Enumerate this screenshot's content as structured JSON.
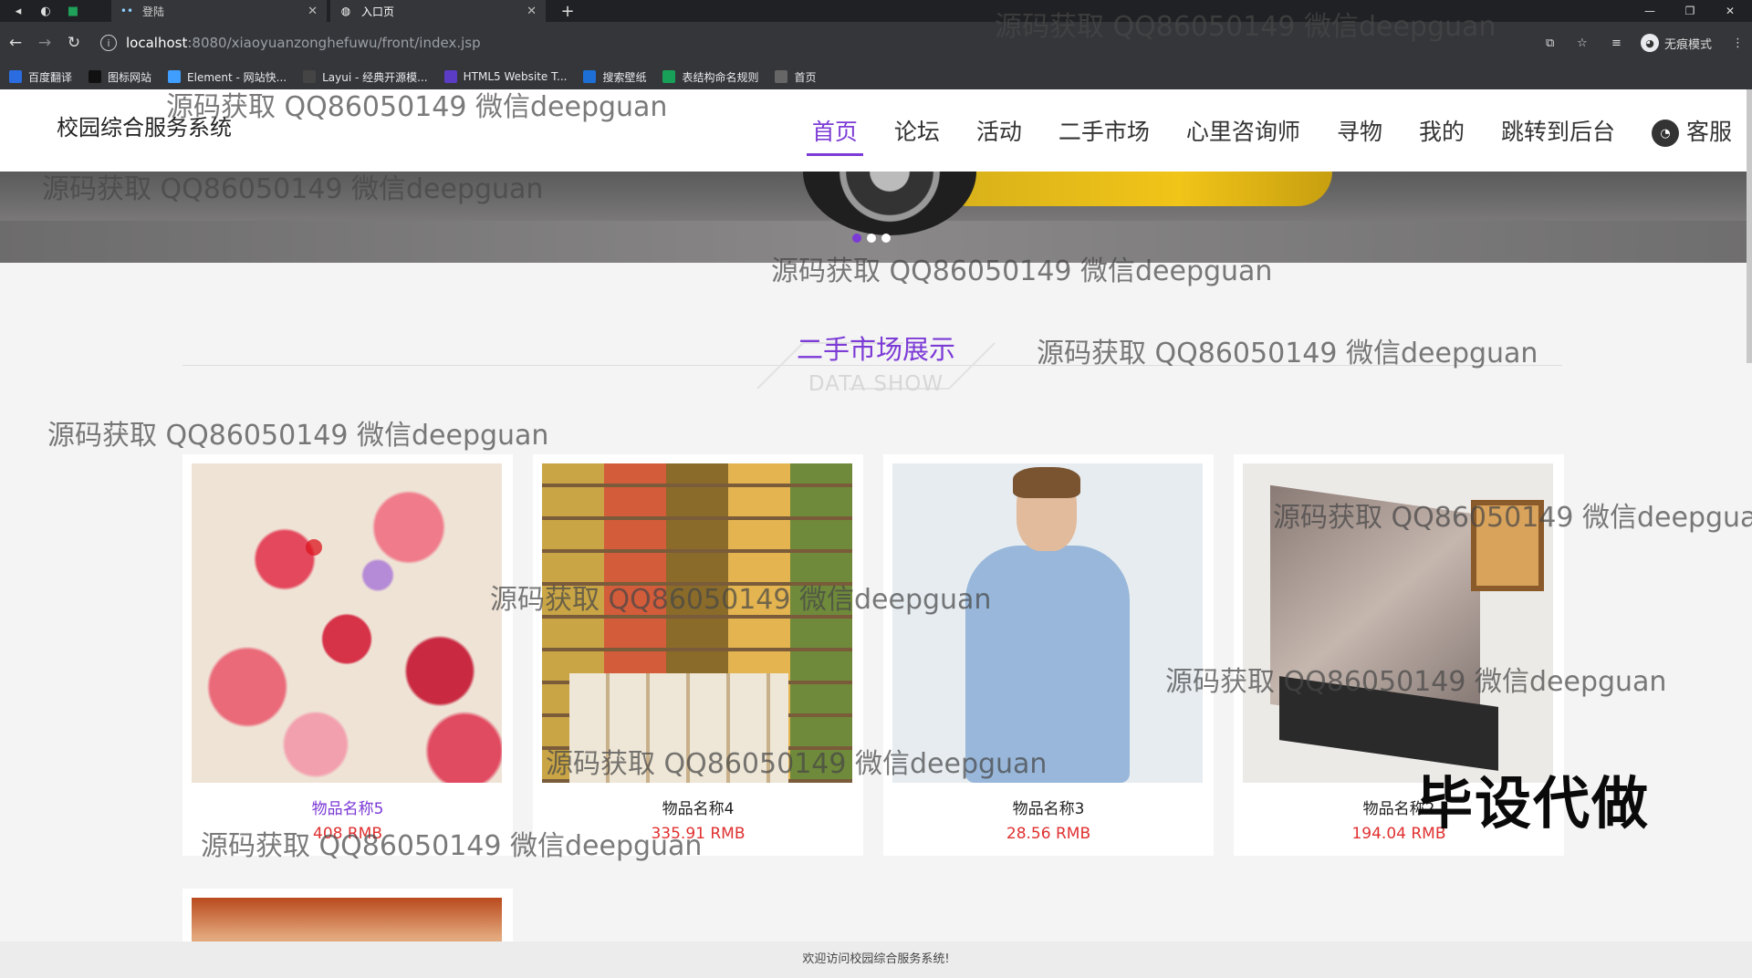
{
  "browser": {
    "tabs": [
      {
        "label": "登陆"
      },
      {
        "label": "入口页"
      }
    ],
    "url_host": "localhost",
    "url_path": ":8080/xiaoyuanzonghefuwu/front/index.jsp",
    "incognito_label": "无痕模式",
    "bookmarks": [
      {
        "label": "百度翻译",
        "color": "#2b6de0"
      },
      {
        "label": "图标网站",
        "color": "#111111"
      },
      {
        "label": "Element - 网站快...",
        "color": "#409eff"
      },
      {
        "label": "Layui - 经典开源模...",
        "color": "#444444"
      },
      {
        "label": "HTML5 Website T...",
        "color": "#5b3cc4"
      },
      {
        "label": "搜索壁纸",
        "color": "#1d6fd6"
      },
      {
        "label": "表结构命名规则",
        "color": "#18a058"
      },
      {
        "label": "首页",
        "color": "#666666"
      }
    ]
  },
  "site": {
    "brand": "校园综合服务系统",
    "menu": [
      {
        "label": "首页",
        "active": true
      },
      {
        "label": "论坛"
      },
      {
        "label": "活动"
      },
      {
        "label": "二手市场"
      },
      {
        "label": "心里咨询师"
      },
      {
        "label": "寻物"
      },
      {
        "label": "我的"
      },
      {
        "label": "跳转到后台"
      }
    ],
    "service_label": "客服",
    "accent_color": "#7c3bd6"
  },
  "section": {
    "title": "二手市场展示",
    "subtitle": "DATA SHOW"
  },
  "products": [
    {
      "name": "物品名称5",
      "price": "408 RMB"
    },
    {
      "name": "物品名称4",
      "price": "335.91 RMB"
    },
    {
      "name": "物品名称3",
      "price": "28.56 RMB"
    },
    {
      "name": "物品名称2",
      "price": "194.04 RMB"
    }
  ],
  "footer": "欢迎访问校园综合服务系统!",
  "overlay": {
    "watermark": "源码获取 QQ86050149 微信deepguan",
    "stamp": "毕设代做"
  }
}
